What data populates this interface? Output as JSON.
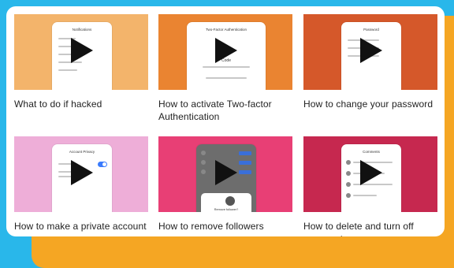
{
  "colors": {
    "page_bg": "#29b7ea",
    "accent_orange": "#f5a623",
    "panel": "#ffffff"
  },
  "icons": {
    "play": "play-icon"
  },
  "tiles": [
    {
      "caption": "What to do if hacked",
      "bg": "#f3b46b",
      "screen_title": "Notifications"
    },
    {
      "caption": "How to activate Two-factor Authentication",
      "bg": "#ea8431",
      "screen_title": "Two-Factor Authentication",
      "screen_sub": "Code"
    },
    {
      "caption": "How to change your password",
      "bg": "#d5582a",
      "screen_title": "Password"
    },
    {
      "caption": "How to make a private account",
      "bg": "#eeaed8",
      "screen_title": "Account Privacy"
    },
    {
      "caption": "How to remove followers",
      "bg": "#e83f75",
      "screen_title": "Remove follower?"
    },
    {
      "caption": "How to delete and turn off comments",
      "bg": "#c6284f",
      "screen_title": "Comments"
    }
  ]
}
